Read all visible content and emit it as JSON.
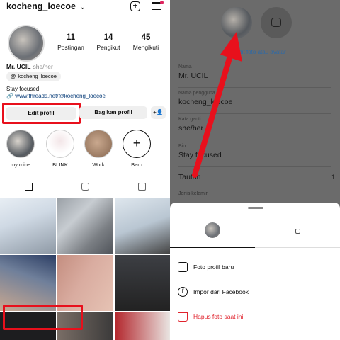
{
  "left": {
    "username": "kocheng_loecoe",
    "stats": [
      {
        "num": "11",
        "label": "Postingan"
      },
      {
        "num": "14",
        "label": "Pengikut"
      },
      {
        "num": "45",
        "label": "Mengikuti"
      }
    ],
    "name": "Mr. UCIL",
    "pronoun": "she/her",
    "threads_handle": "kocheng_loecoe",
    "bio": "Stay focused",
    "link": "www.threads.net/@kocheng_loecoe",
    "edit_profile": "Edit profil",
    "share_profile": "Bagikan profil",
    "highlights": [
      "my mine",
      "BLINK",
      "Work",
      "Baru"
    ]
  },
  "right": {
    "edit_photo_link": "Edit foto atau avatar",
    "fields": [
      {
        "label": "Nama",
        "value": "Mr. UCIL"
      },
      {
        "label": "Nama pengguna",
        "value": "kocheng_loecoe"
      },
      {
        "label": "Kata ganti",
        "value": "she/her"
      },
      {
        "label": "Bio",
        "value": "Stay focused"
      }
    ],
    "tautan": "Tautan",
    "tautan_count": "1",
    "gender_label": "Jenis kelamin",
    "sheet_options": [
      "Foto profil baru",
      "Impor dari Facebook",
      "Hapus foto saat ini"
    ]
  },
  "colors": {
    "highlight_red": "#e8101c",
    "danger_text": "#e0232d",
    "link_blue": "#2d6aa8",
    "overlay_gray": "#6b6b6b"
  }
}
